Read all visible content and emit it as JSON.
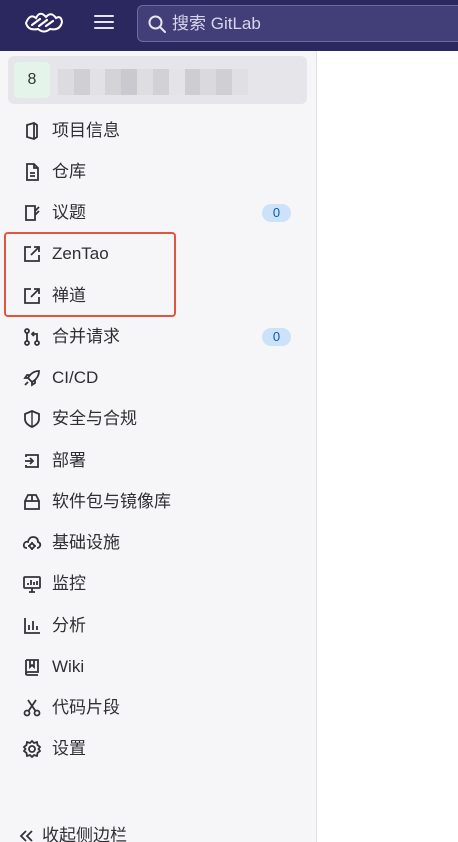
{
  "topbar": {
    "search": {
      "placeholder": "搜索 GitLab"
    },
    "colors": {
      "bar": "#2b2860",
      "accent": "#e05540"
    }
  },
  "sidebar": {
    "project": {
      "avatar_letter": "8"
    },
    "items": [
      {
        "label": "项目信息",
        "icon": "project-info-icon"
      },
      {
        "label": "仓库",
        "icon": "repository-icon"
      },
      {
        "label": "议题",
        "icon": "issues-icon",
        "badge": "0"
      },
      {
        "label": "ZenTao",
        "icon": "external-link-icon"
      },
      {
        "label": "禅道",
        "icon": "external-link-icon"
      },
      {
        "label": "合并请求",
        "icon": "merge-request-icon",
        "badge": "0"
      },
      {
        "label": "CI/CD",
        "icon": "rocket-icon"
      },
      {
        "label": "安全与合规",
        "icon": "shield-icon"
      },
      {
        "label": "部署",
        "icon": "deployments-icon"
      },
      {
        "label": "软件包与镜像库",
        "icon": "package-icon"
      },
      {
        "label": "基础设施",
        "icon": "cloud-gear-icon"
      },
      {
        "label": "监控",
        "icon": "monitor-icon"
      },
      {
        "label": "分析",
        "icon": "chart-icon"
      },
      {
        "label": "Wiki",
        "icon": "book-icon"
      },
      {
        "label": "代码片段",
        "icon": "scissors-icon"
      },
      {
        "label": "设置",
        "icon": "gear-icon"
      }
    ],
    "collapse_label": "收起侧边栏"
  }
}
